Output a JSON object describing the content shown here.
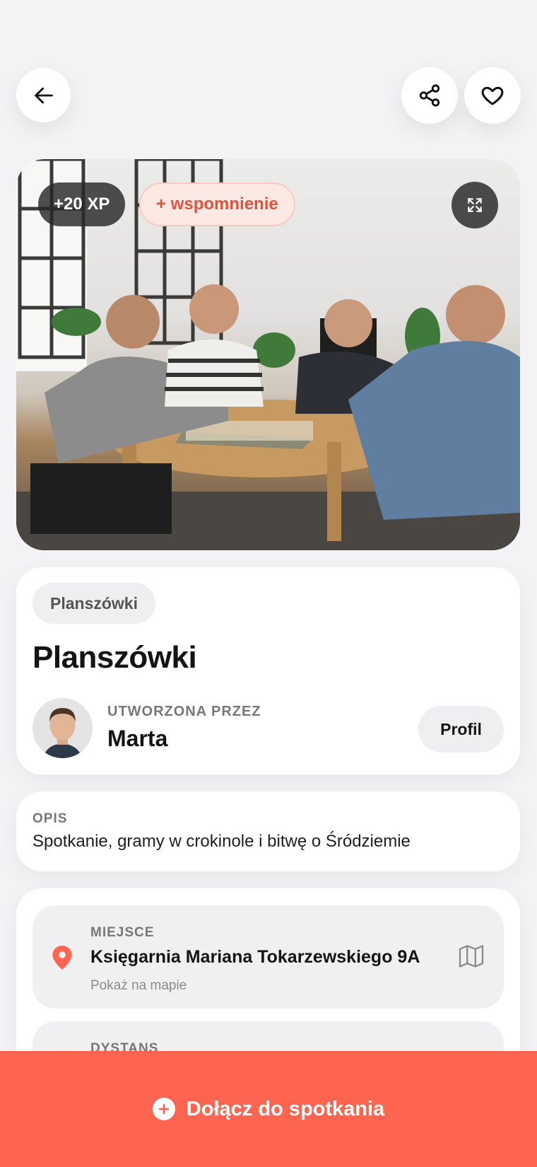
{
  "header": {
    "back_icon": "arrow-left-icon",
    "share_icon": "share-icon",
    "favorite_icon": "heart-outline-icon"
  },
  "hero": {
    "xp_badge": "+20 XP",
    "memory_badge": "+ wspomnienie",
    "expand_icon": "expand-icon",
    "image_description": "Group photo"
  },
  "event": {
    "category": "Planszówki",
    "title": "Planszówki",
    "created_by_label": "UTWORZONA PRZEZ",
    "creator_name": "Marta",
    "profile_button": "Profil"
  },
  "description": {
    "label": "OPIS",
    "text": "Spotkanie, gramy w crokinole i bitwę o Śródziemie"
  },
  "place": {
    "label": "MIEJSCE",
    "value": "Księgarnia Mariana Tokarzewskiego 9A",
    "link": "Pokaż na mapie",
    "pin_icon": "location-pin-icon",
    "map_icon": "map-icon"
  },
  "distance": {
    "label": "DYSTANS"
  },
  "cta": {
    "label": "Dołącz do spotkania",
    "icon": "plus-circle-icon"
  },
  "colors": {
    "accent": "#fe6550",
    "badge_text": "#e0533e",
    "background": "#f3f3f5"
  }
}
